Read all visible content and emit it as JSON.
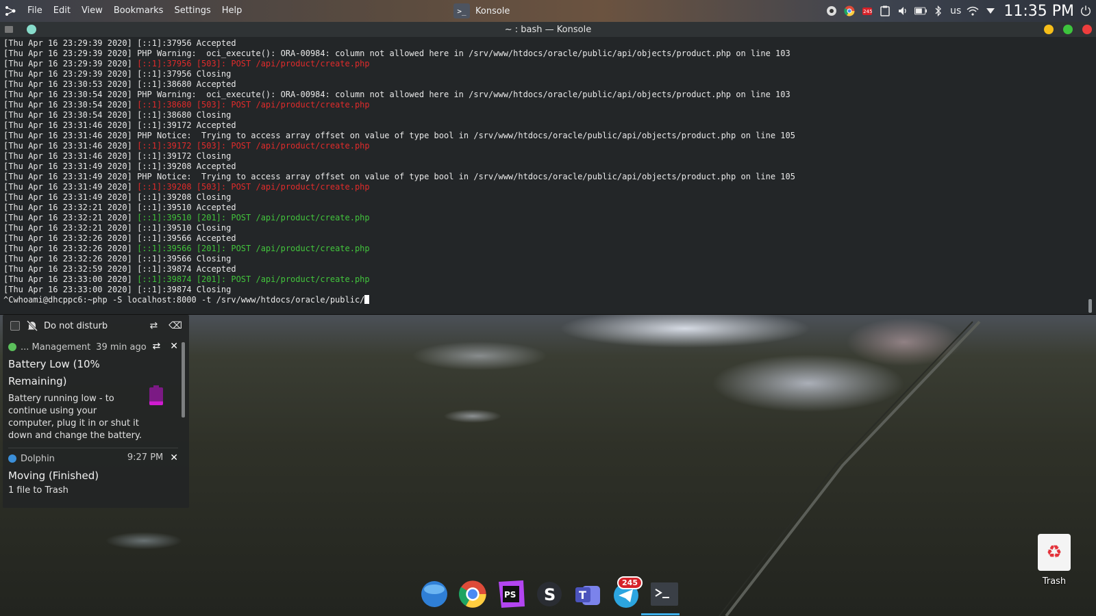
{
  "menubar": [
    "File",
    "Edit",
    "View",
    "Bookmarks",
    "Settings",
    "Help"
  ],
  "taskbar": {
    "active_app": "Konsole"
  },
  "tray": {
    "telegram_badge": "245",
    "keyboard_layout": "us",
    "clock": "11:35 PM"
  },
  "konsole": {
    "title": "~ : bash — Konsole",
    "lines": [
      {
        "p": "[Thu Apr 16 23:29:39 2020] ",
        "t": "[::1]:37956 Accepted",
        "c": ""
      },
      {
        "p": "[Thu Apr 16 23:29:39 2020] ",
        "t": "PHP Warning:  oci_execute(): ORA-00984: column not allowed here in /srv/www/htdocs/oracle/public/api/objects/product.php on line 103",
        "c": ""
      },
      {
        "p": "[Thu Apr 16 23:29:39 2020] ",
        "t": "[::1]:37956 [503]: POST /api/product/create.php",
        "c": "red"
      },
      {
        "p": "[Thu Apr 16 23:29:39 2020] ",
        "t": "[::1]:37956 Closing",
        "c": ""
      },
      {
        "p": "[Thu Apr 16 23:30:53 2020] ",
        "t": "[::1]:38680 Accepted",
        "c": ""
      },
      {
        "p": "[Thu Apr 16 23:30:54 2020] ",
        "t": "PHP Warning:  oci_execute(): ORA-00984: column not allowed here in /srv/www/htdocs/oracle/public/api/objects/product.php on line 103",
        "c": ""
      },
      {
        "p": "[Thu Apr 16 23:30:54 2020] ",
        "t": "[::1]:38680 [503]: POST /api/product/create.php",
        "c": "red"
      },
      {
        "p": "[Thu Apr 16 23:30:54 2020] ",
        "t": "[::1]:38680 Closing",
        "c": ""
      },
      {
        "p": "[Thu Apr 16 23:31:46 2020] ",
        "t": "[::1]:39172 Accepted",
        "c": ""
      },
      {
        "p": "[Thu Apr 16 23:31:46 2020] ",
        "t": "PHP Notice:  Trying to access array offset on value of type bool in /srv/www/htdocs/oracle/public/api/objects/product.php on line 105",
        "c": ""
      },
      {
        "p": "[Thu Apr 16 23:31:46 2020] ",
        "t": "[::1]:39172 [503]: POST /api/product/create.php",
        "c": "red"
      },
      {
        "p": "[Thu Apr 16 23:31:46 2020] ",
        "t": "[::1]:39172 Closing",
        "c": ""
      },
      {
        "p": "[Thu Apr 16 23:31:49 2020] ",
        "t": "[::1]:39208 Accepted",
        "c": ""
      },
      {
        "p": "[Thu Apr 16 23:31:49 2020] ",
        "t": "PHP Notice:  Trying to access array offset on value of type bool in /srv/www/htdocs/oracle/public/api/objects/product.php on line 105",
        "c": ""
      },
      {
        "p": "[Thu Apr 16 23:31:49 2020] ",
        "t": "[::1]:39208 [503]: POST /api/product/create.php",
        "c": "red"
      },
      {
        "p": "[Thu Apr 16 23:31:49 2020] ",
        "t": "[::1]:39208 Closing",
        "c": ""
      },
      {
        "p": "[Thu Apr 16 23:32:21 2020] ",
        "t": "[::1]:39510 Accepted",
        "c": ""
      },
      {
        "p": "[Thu Apr 16 23:32:21 2020] ",
        "t": "[::1]:39510 [201]: POST /api/product/create.php",
        "c": "green"
      },
      {
        "p": "[Thu Apr 16 23:32:21 2020] ",
        "t": "[::1]:39510 Closing",
        "c": ""
      },
      {
        "p": "[Thu Apr 16 23:32:26 2020] ",
        "t": "[::1]:39566 Accepted",
        "c": ""
      },
      {
        "p": "[Thu Apr 16 23:32:26 2020] ",
        "t": "[::1]:39566 [201]: POST /api/product/create.php",
        "c": "green"
      },
      {
        "p": "[Thu Apr 16 23:32:26 2020] ",
        "t": "[::1]:39566 Closing",
        "c": ""
      },
      {
        "p": "[Thu Apr 16 23:32:59 2020] ",
        "t": "[::1]:39874 Accepted",
        "c": ""
      },
      {
        "p": "[Thu Apr 16 23:33:00 2020] ",
        "t": "[::1]:39874 [201]: POST /api/product/create.php",
        "c": "green"
      },
      {
        "p": "[Thu Apr 16 23:33:00 2020] ",
        "t": "[::1]:39874 Closing",
        "c": ""
      }
    ],
    "prompt": "^Cwhoami@dhcppc6:~php -S localhost:8000 -t /srv/www/htdocs/oracle/public/"
  },
  "notifications": {
    "dnd_label": "Do not disturb",
    "items": [
      {
        "app": "... Management",
        "time": "39 min ago",
        "title": "Battery Low (10% Remaining)",
        "body": "Battery running low - to continue using your computer, plug it in or shut it down and change the battery."
      },
      {
        "app": "Dolphin",
        "time": "9:27 PM",
        "title": "Moving (Finished)",
        "body": "1 file to Trash"
      }
    ]
  },
  "dock": {
    "telegram_badge": "245"
  },
  "desktop": {
    "trash_label": "Trash"
  },
  "colors": {
    "error": "#e12b2b",
    "success": "#42c43c",
    "accent": "#3daee9"
  }
}
